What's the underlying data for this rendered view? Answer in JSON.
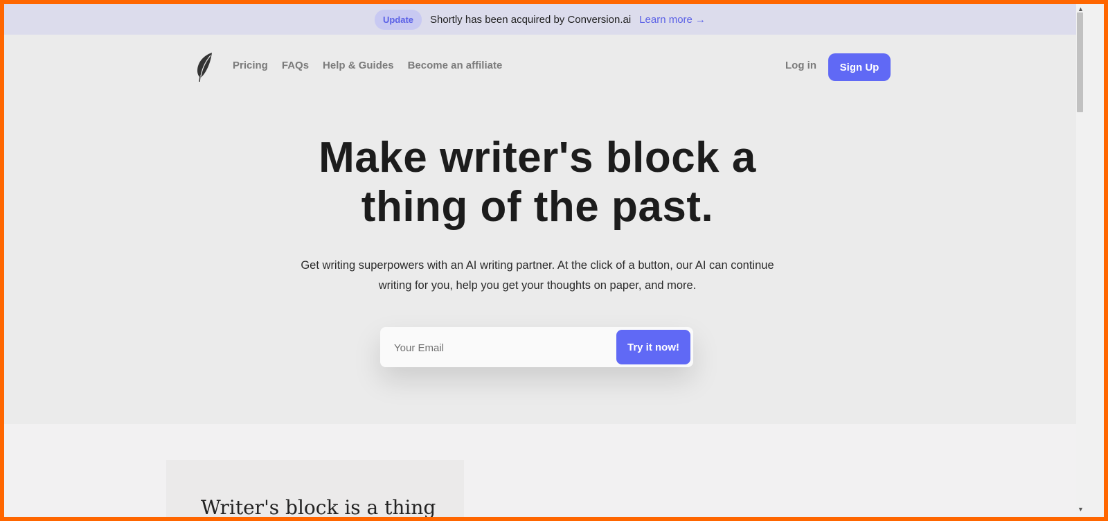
{
  "announcement": {
    "badge": "Update",
    "message": "Shortly has been acquired by Conversion.ai",
    "link": "Learn more →"
  },
  "header": {
    "logo_icon": "feather-icon",
    "nav": [
      "Pricing",
      "FAQs",
      "Help & Guides",
      "Become an affiliate"
    ],
    "login": "Log in",
    "signup": "Sign Up"
  },
  "hero": {
    "title_line1": "Make writer's block a",
    "title_line2": "thing of the past.",
    "subtitle_line1": "Get writing superpowers with an AI writing partner. At the click of a button, our AI can continue",
    "subtitle_line2": "writing for you, help you get your thoughts on paper, and more.",
    "email_placeholder": "Your Email",
    "cta": "Try it now!"
  },
  "lower": {
    "card_title_partial": "Writer's block is a thing"
  },
  "colors": {
    "accent": "#6069f5",
    "banner": "#dcdcec",
    "badge": "#c8c9f2",
    "hero_bg": "#ebebeb",
    "frame": "#ff6600"
  }
}
